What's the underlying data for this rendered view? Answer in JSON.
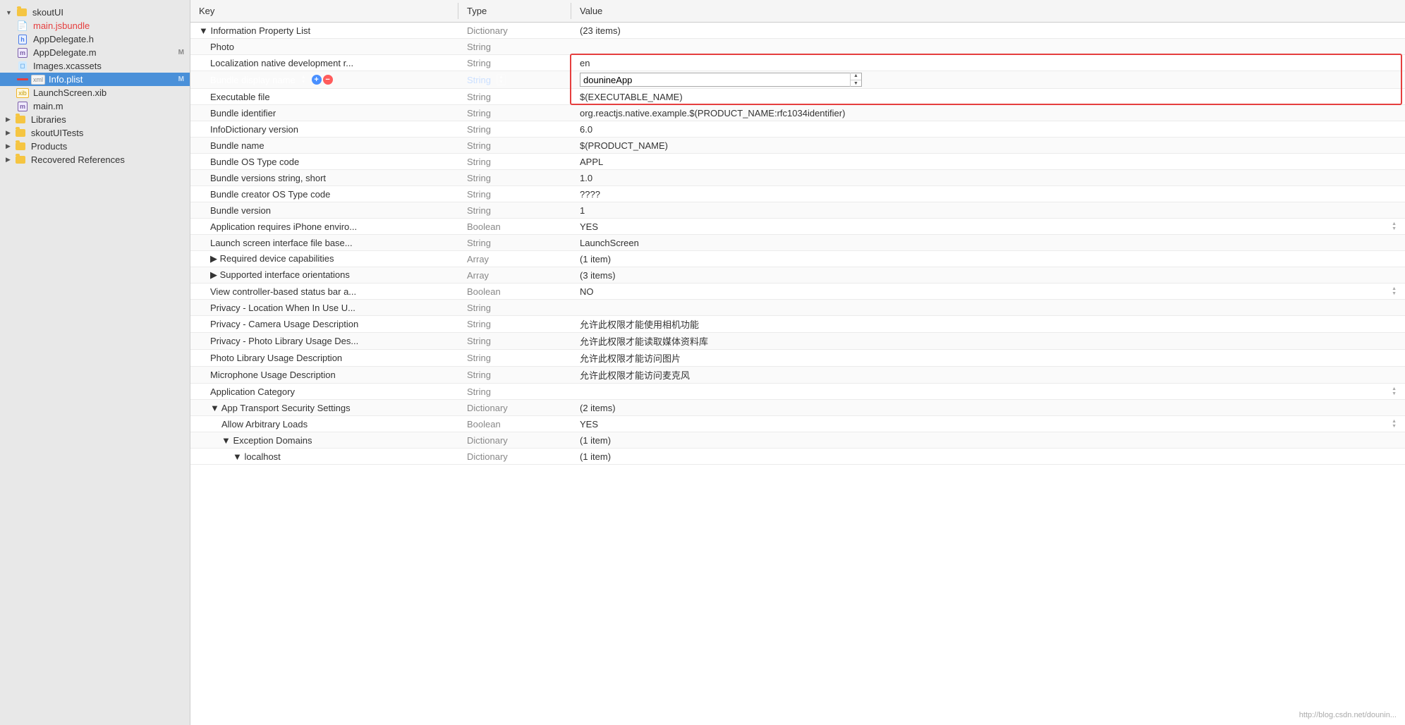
{
  "sidebar": {
    "root_label": "skoutUI",
    "items": [
      {
        "id": "root-group",
        "label": "skoutUI",
        "indent": 0,
        "type": "folder-open",
        "selected": false
      },
      {
        "id": "main-jsbundle",
        "label": "main.jsbundle",
        "indent": 1,
        "type": "js",
        "selected": false
      },
      {
        "id": "appdelegate-h",
        "label": "AppDelegate.h",
        "indent": 1,
        "type": "h",
        "selected": false
      },
      {
        "id": "appdelegate-m",
        "label": "AppDelegate.m",
        "indent": 1,
        "type": "m",
        "badge": "M",
        "selected": false
      },
      {
        "id": "images-xcassets",
        "label": "Images.xcassets",
        "indent": 1,
        "type": "xcassets",
        "selected": false
      },
      {
        "id": "info-plist",
        "label": "Info.plist",
        "indent": 1,
        "type": "plist",
        "badge": "M",
        "selected": true,
        "has-red": true
      },
      {
        "id": "launchscreen-xib",
        "label": "LaunchScreen.xib",
        "indent": 1,
        "type": "xib",
        "selected": false
      },
      {
        "id": "main-m",
        "label": "main.m",
        "indent": 1,
        "type": "m",
        "selected": false
      },
      {
        "id": "libraries",
        "label": "Libraries",
        "indent": 0,
        "type": "folder-closed",
        "selected": false
      },
      {
        "id": "skoutuitests",
        "label": "skoutUITests",
        "indent": 0,
        "type": "folder-closed",
        "selected": false
      },
      {
        "id": "products",
        "label": "Products",
        "indent": 0,
        "type": "folder-closed",
        "selected": false
      },
      {
        "id": "recovered-references",
        "label": "Recovered References",
        "indent": 0,
        "type": "folder-closed",
        "selected": false
      }
    ]
  },
  "plist": {
    "header": {
      "key": "Key",
      "type": "Type",
      "value": "Value"
    },
    "rows": [
      {
        "id": "info-property-list",
        "indent": 0,
        "expanded": true,
        "key": "▼ Information Property List",
        "type": "Dictionary",
        "value": "(23 items)",
        "alt": false,
        "selected": false
      },
      {
        "id": "photo",
        "indent": 1,
        "key": "Photo",
        "type": "String",
        "value": "",
        "alt": true,
        "selected": false
      },
      {
        "id": "localization",
        "indent": 1,
        "key": "Localization native development r...",
        "type": "String",
        "value": "en",
        "alt": false,
        "selected": false,
        "value-editing": true,
        "value-red-box": true
      },
      {
        "id": "bundle-display-name",
        "indent": 1,
        "key": "Bundle display name",
        "type": "String",
        "value": "dounineApp",
        "alt": true,
        "selected": true,
        "editing": true,
        "has-plus-minus": true
      },
      {
        "id": "executable-file",
        "indent": 1,
        "key": "Executable file",
        "type": "String",
        "value": "$(EXECUTABLE_NAME)",
        "alt": false,
        "selected": false,
        "value-red-box": true
      },
      {
        "id": "bundle-identifier",
        "indent": 1,
        "key": "Bundle identifier",
        "type": "String",
        "value": "org.reactjs.native.example.$(PRODUCT_NAME:rfc1034identifier)",
        "alt": true,
        "selected": false
      },
      {
        "id": "infodictionary-version",
        "indent": 1,
        "key": "InfoDictionary version",
        "type": "String",
        "value": "6.0",
        "alt": false,
        "selected": false
      },
      {
        "id": "bundle-name",
        "indent": 1,
        "key": "Bundle name",
        "type": "String",
        "value": "$(PRODUCT_NAME)",
        "alt": true,
        "selected": false
      },
      {
        "id": "bundle-os-type",
        "indent": 1,
        "key": "Bundle OS Type code",
        "type": "String",
        "value": "APPL",
        "alt": false,
        "selected": false
      },
      {
        "id": "bundle-versions-short",
        "indent": 1,
        "key": "Bundle versions string, short",
        "type": "String",
        "value": "1.0",
        "alt": true,
        "selected": false
      },
      {
        "id": "bundle-creator-os",
        "indent": 1,
        "key": "Bundle creator OS Type code",
        "type": "String",
        "value": "????",
        "alt": false,
        "selected": false
      },
      {
        "id": "bundle-version",
        "indent": 1,
        "key": "Bundle version",
        "type": "String",
        "value": "1",
        "alt": true,
        "selected": false
      },
      {
        "id": "app-requires-iphone",
        "indent": 1,
        "key": "Application requires iPhone enviro...",
        "type": "Boolean",
        "value": "YES",
        "alt": false,
        "selected": false,
        "has-stepper": true
      },
      {
        "id": "launch-screen",
        "indent": 1,
        "key": "Launch screen interface file base...",
        "type": "String",
        "value": "LaunchScreen",
        "alt": true,
        "selected": false
      },
      {
        "id": "required-device",
        "indent": 1,
        "key": "▶ Required device capabilities",
        "type": "Array",
        "value": "(1 item)",
        "alt": false,
        "selected": false
      },
      {
        "id": "supported-orientations",
        "indent": 1,
        "key": "▶ Supported interface orientations",
        "type": "Array",
        "value": "(3 items)",
        "alt": true,
        "selected": false
      },
      {
        "id": "view-controller-status",
        "indent": 1,
        "key": "View controller-based status bar a...",
        "type": "Boolean",
        "value": "NO",
        "alt": false,
        "selected": false,
        "has-stepper": true
      },
      {
        "id": "privacy-location",
        "indent": 1,
        "key": "Privacy - Location When In Use U...",
        "type": "String",
        "value": "",
        "alt": true,
        "selected": false
      },
      {
        "id": "privacy-camera",
        "indent": 1,
        "key": "Privacy - Camera Usage Description",
        "type": "String",
        "value": "允许此权限才能使用相机功能",
        "alt": false,
        "selected": false
      },
      {
        "id": "privacy-photo-library",
        "indent": 1,
        "key": "Privacy - Photo Library Usage Des...",
        "type": "String",
        "value": "允许此权限才能读取媒体资料库",
        "alt": true,
        "selected": false
      },
      {
        "id": "photo-library-usage",
        "indent": 1,
        "key": "Photo Library Usage Description",
        "type": "String",
        "value": "允许此权限才能访问图片",
        "alt": false,
        "selected": false
      },
      {
        "id": "microphone-usage",
        "indent": 1,
        "key": "Microphone Usage Description",
        "type": "String",
        "value": "允许此权限才能访问麦克风",
        "alt": true,
        "selected": false
      },
      {
        "id": "application-category",
        "indent": 1,
        "key": "Application Category",
        "type": "String",
        "value": "",
        "alt": false,
        "selected": false,
        "has-stepper": true
      },
      {
        "id": "app-transport-security",
        "indent": 1,
        "key": "▼ App Transport Security Settings",
        "type": "Dictionary",
        "value": "(2 items)",
        "alt": true,
        "selected": false
      },
      {
        "id": "allow-arbitrary-loads",
        "indent": 2,
        "key": "Allow Arbitrary Loads",
        "type": "Boolean",
        "value": "YES",
        "alt": false,
        "selected": false,
        "has-stepper": true
      },
      {
        "id": "exception-domains",
        "indent": 2,
        "key": "▼ Exception Domains",
        "type": "Dictionary",
        "value": "(1 item)",
        "alt": true,
        "selected": false
      },
      {
        "id": "localhost",
        "indent": 3,
        "key": "▼ localhost",
        "type": "Dictionary",
        "value": "(1 item)",
        "alt": false,
        "selected": false
      }
    ]
  },
  "watermark": "http://blog.csdn.net/dounin..."
}
